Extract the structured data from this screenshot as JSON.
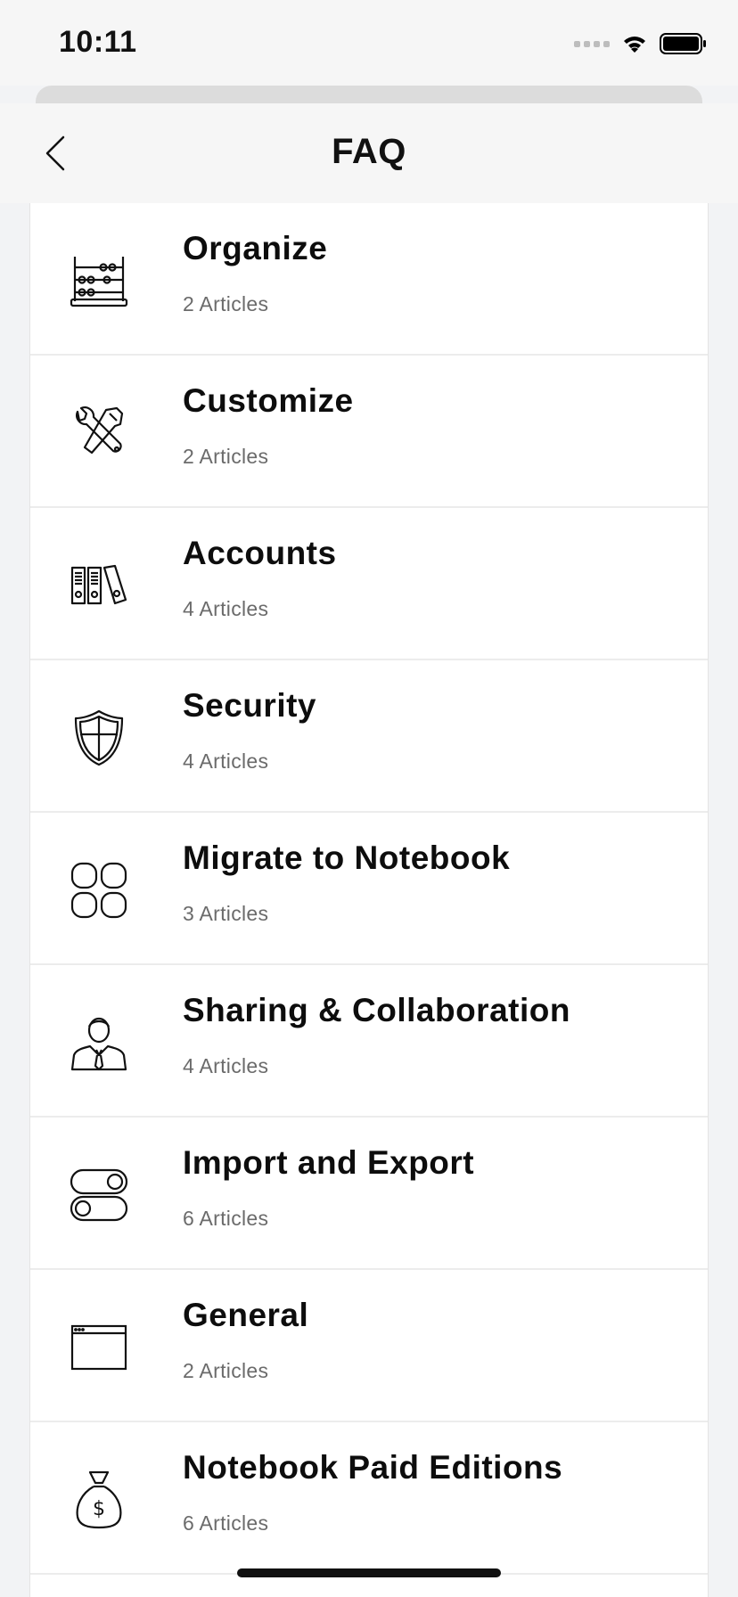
{
  "status_bar": {
    "time": "10:11"
  },
  "nav": {
    "title": "FAQ",
    "back_icon": "chevron-left-icon"
  },
  "categories": [
    {
      "title": "Organize",
      "count": "2 Articles",
      "icon": "abacus-icon"
    },
    {
      "title": "Customize",
      "count": "2 Articles",
      "icon": "tools-icon"
    },
    {
      "title": "Accounts",
      "count": "4 Articles",
      "icon": "binders-icon"
    },
    {
      "title": "Security",
      "count": "4 Articles",
      "icon": "shield-icon"
    },
    {
      "title": "Migrate to Notebook",
      "count": "3 Articles",
      "icon": "grid-icon"
    },
    {
      "title": "Sharing & Collaboration",
      "count": "4 Articles",
      "icon": "person-icon"
    },
    {
      "title": "Import and Export",
      "count": "6 Articles",
      "icon": "toggles-icon"
    },
    {
      "title": "General",
      "count": "2 Articles",
      "icon": "window-icon"
    },
    {
      "title": "Notebook Paid Editions",
      "count": "6 Articles",
      "icon": "money-bag-icon"
    }
  ]
}
